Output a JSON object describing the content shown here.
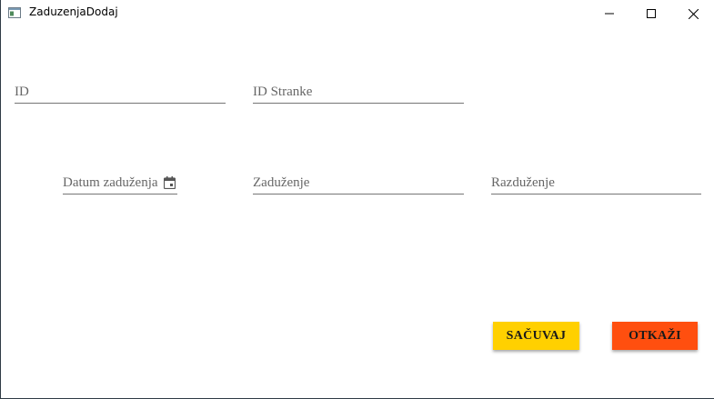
{
  "window": {
    "title": "ZaduzenjaDodaj",
    "icon": "app-window-icon"
  },
  "form": {
    "id": {
      "placeholder": "ID",
      "value": ""
    },
    "id_stranke": {
      "placeholder": "ID Stranke",
      "value": ""
    },
    "datum_zaduzenja": {
      "placeholder": "Datum zaduženja",
      "value": "",
      "icon": "calendar-icon"
    },
    "zaduzenje": {
      "placeholder": "Zaduženje",
      "value": ""
    },
    "razduzenje": {
      "placeholder": "Razduženje",
      "value": ""
    }
  },
  "actions": {
    "save_label": "SAČUVAJ",
    "cancel_label": "OTKAŽI"
  },
  "colors": {
    "save_button": "#ffd000",
    "cancel_button": "#ff4f0f",
    "underline": "#757575",
    "placeholder": "#666666"
  }
}
